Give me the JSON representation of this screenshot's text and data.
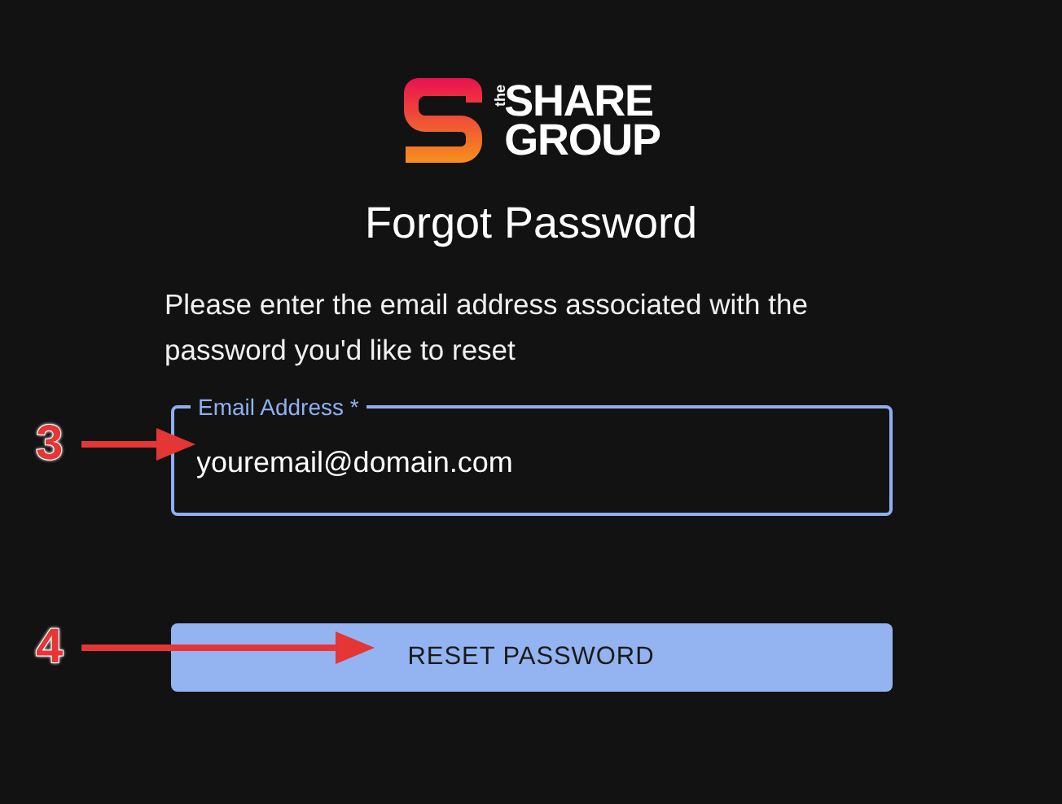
{
  "logo": {
    "small": "the",
    "line1": "SHARE",
    "line2": "GROUP"
  },
  "title": "Forgot Password",
  "instructions": "Please enter the email address associated with the password you'd like to reset",
  "email_field": {
    "label": "Email Address *",
    "value": "youremail@domain.com"
  },
  "button": "RESET PASSWORD",
  "annotations": [
    {
      "number": "3",
      "kind": "short"
    },
    {
      "number": "4",
      "kind": "long"
    }
  ]
}
